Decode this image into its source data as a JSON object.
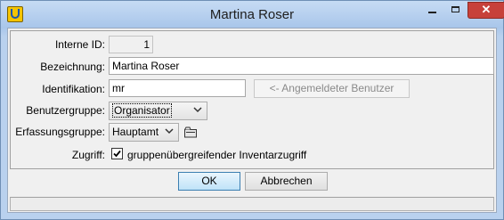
{
  "window": {
    "title": "Martina Roser",
    "close_symbol": "✕",
    "icons": {
      "app": "app-logo-icon",
      "minimize": "minimize-icon",
      "maximize": "maximize-icon",
      "close": "close-icon"
    }
  },
  "form": {
    "interne_id": {
      "label": "Interne ID:",
      "value": "1"
    },
    "bezeichnung": {
      "label": "Bezeichnung:",
      "value": "Martina Roser"
    },
    "identifikation": {
      "label": "Identifikation:",
      "value": "mr",
      "button": "<- Angemeldeter Benutzer"
    },
    "benutzergruppe": {
      "label": "Benutzergruppe:",
      "selected": "Organisator"
    },
    "erfassungsgruppe": {
      "label": "Erfassungsgruppe:",
      "selected": "Hauptamt",
      "extra_icon": "folder-icon"
    },
    "zugriff": {
      "label": "Zugriff:",
      "checkbox_label": "gruppenübergreifender Inventarzugriff",
      "checked": true
    }
  },
  "buttons": {
    "ok": "OK",
    "cancel": "Abbrechen"
  },
  "statusbar": {
    "text": ""
  }
}
